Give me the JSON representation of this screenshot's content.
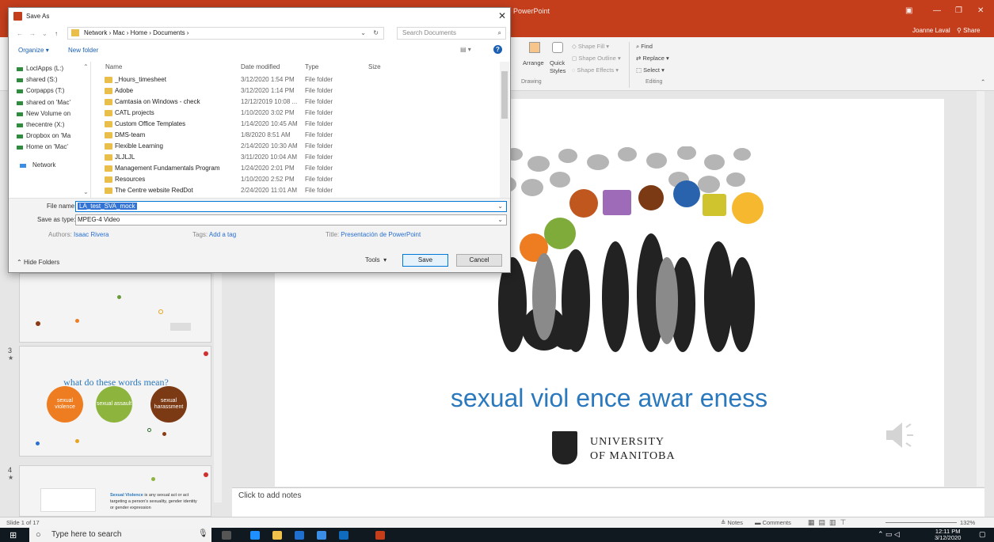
{
  "ppt": {
    "app_title": "PowerPoint",
    "user": "Joanne Laval",
    "share": "Share"
  },
  "ribbon": {
    "find": "Find",
    "replace": "Replace",
    "select": "Select",
    "shape_fill": "Shape Fill",
    "shape_outline": "Shape Outline",
    "shape_effects": "Shape Effects",
    "arrange": "Arrange",
    "quick": "Quick",
    "styles": "Styles",
    "group_drawing": "Drawing",
    "group_editing": "Editing"
  },
  "dialog": {
    "title": "Save As",
    "breadcrumb": "Network  ›  Mac  ›  Home  ›  Documents  ›",
    "search_placeholder": "Search Documents",
    "organize": "Organize",
    "new_folder": "New folder",
    "nav_items": [
      "LoclApps (L:)",
      "shared (S:)",
      "Corpapps (T:)",
      "shared on 'Mac'",
      "New Volume on",
      "thecentre (X:)",
      "Dropbox on 'Ma",
      "Home on 'Mac'",
      "Network"
    ],
    "columns": {
      "name": "Name",
      "date": "Date modified",
      "type": "Type",
      "size": "Size"
    },
    "files": [
      {
        "name": "_Hours_timesheet",
        "date": "3/12/2020 1:54 PM",
        "type": "File folder"
      },
      {
        "name": "Adobe",
        "date": "3/12/2020 1:14 PM",
        "type": "File folder"
      },
      {
        "name": "Camtasia on Windows - check",
        "date": "12/12/2019 10:08 ...",
        "type": "File folder"
      },
      {
        "name": "CATL projects",
        "date": "1/10/2020 3:02 PM",
        "type": "File folder"
      },
      {
        "name": "Custom Office Templates",
        "date": "1/14/2020 10:45 AM",
        "type": "File folder"
      },
      {
        "name": "DMS-team",
        "date": "1/8/2020 8:51 AM",
        "type": "File folder"
      },
      {
        "name": "Flexible Learning",
        "date": "2/14/2020 10:30 AM",
        "type": "File folder"
      },
      {
        "name": "JLJLJL",
        "date": "3/11/2020 10:04 AM",
        "type": "File folder"
      },
      {
        "name": "Management Fundamentals Program",
        "date": "1/24/2020 2:01 PM",
        "type": "File folder"
      },
      {
        "name": "Resources",
        "date": "1/10/2020 2:52 PM",
        "type": "File folder"
      },
      {
        "name": "The Centre website RedDot",
        "date": "2/24/2020 11:01 AM",
        "type": "File folder"
      }
    ],
    "file_name_label": "File name:",
    "file_name_value": "LA_test_SVA_mock",
    "save_as_type_label": "Save as type:",
    "save_as_type_value": "MPEG-4 Video",
    "authors_label": "Authors:",
    "authors_value": "Isaac Rivera",
    "tags_label": "Tags:",
    "tags_value": "Add a tag",
    "title_label": "Title:",
    "title_value": "Presentación de PowerPoint",
    "hide_folders": "Hide Folders",
    "tools": "Tools",
    "save": "Save",
    "cancel": "Cancel"
  },
  "slides": {
    "slide3_number": "3",
    "slide3_title": "what do these words mean?",
    "bubble1": "sexual violence",
    "bubble2": "sexual assault",
    "bubble3": "sexual harassment",
    "slide4_number": "4",
    "slide4_text_bold": "Sexual Violence",
    "slide4_text_rest": "is any sexual act or act targeting a person's sexuality, gender identity or gender expression"
  },
  "main_slide": {
    "title": "sexual viol ence awar eness",
    "university_line1": "UNIVERSITY",
    "university_line2": "OF MANITOBA"
  },
  "notes_placeholder": "Click to add notes",
  "status": {
    "slide_count": "Slide 1 of 17",
    "notes": "Notes",
    "comments": "Comments",
    "zoom": "132%"
  },
  "taskbar": {
    "search_placeholder": "Type here to search",
    "time": "12:11 PM",
    "date": "3/12/2020"
  },
  "colors": {
    "ppt_red": "#c43e1c",
    "title_blue": "#2a78bd",
    "orange": "#ee7d22",
    "green": "#8db43c",
    "brown": "#7b3a14"
  }
}
